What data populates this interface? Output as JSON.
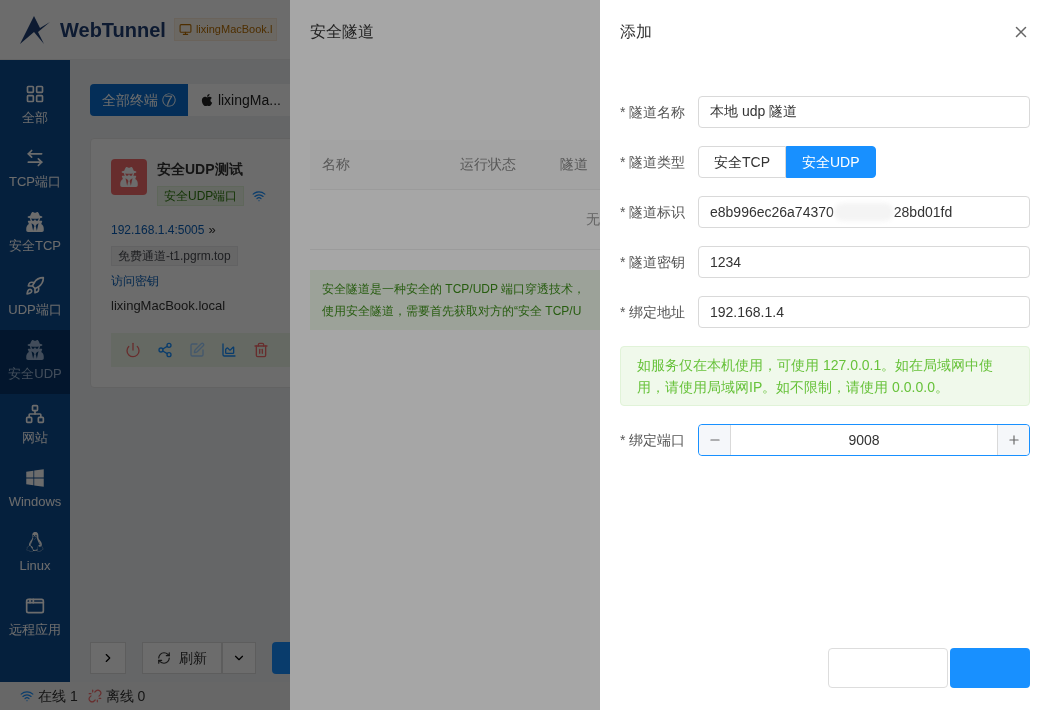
{
  "app": {
    "logo": "WebTunnel",
    "device_tag": "lixingMacBook.l",
    "sidebar": [
      {
        "label": "全部",
        "selected": false
      },
      {
        "label": "TCP端口",
        "selected": false
      },
      {
        "label": "安全TCP",
        "selected": false
      },
      {
        "label": "UDP端口",
        "selected": false
      },
      {
        "label": "安全UDP",
        "selected": true
      },
      {
        "label": "网站",
        "selected": false
      },
      {
        "label": "Windows",
        "selected": false
      },
      {
        "label": "Linux",
        "selected": false
      },
      {
        "label": "远程应用",
        "selected": false
      }
    ],
    "tabs": [
      {
        "label": "全部终端 ⑦",
        "selected": true
      },
      {
        "label": "lixingMa...",
        "selected": false
      }
    ],
    "card": {
      "title": "安全UDP测试",
      "tag": "安全UDP端口",
      "address": "192.168.1.4:5005",
      "address_arrow": "»",
      "channel": "免费通道-t1.pgrm.top",
      "key_link": "访问密钥",
      "host": "lixingMacBook.local"
    },
    "refresh": "刷新",
    "status": {
      "online": "在线 1",
      "offline": "离线 0"
    }
  },
  "tunnel_panel": {
    "title": "安全隧道",
    "columns": [
      "名称",
      "运行状态",
      "隧道"
    ],
    "empty": "无",
    "notice": [
      "安全隧道是一种安全的 TCP/UDP 端口穿透技术，",
      "使用安全隧道，需要首先获取对方的“安全 TCP/U"
    ]
  },
  "form": {
    "title": "添加",
    "fields": [
      {
        "kind": "text",
        "label": "* 隧道名称",
        "value": "本地 udp 隧道"
      },
      {
        "kind": "radio",
        "label": "* 隧道类型",
        "options": [
          {
            "label": "安全TCP",
            "selected": false
          },
          {
            "label": "安全UDP",
            "selected": true
          }
        ]
      },
      {
        "kind": "masked",
        "label": "* 隧道标识",
        "value_parts": [
          "e8b996ec26a74370",
          "28bd01fd"
        ]
      },
      {
        "kind": "text",
        "label": "* 隧道密钥",
        "value": "1234"
      },
      {
        "kind": "text",
        "label": "* 绑定地址",
        "value": "192.168.1.4"
      },
      {
        "kind": "hint",
        "text": "如服务仅在本机使用，可使用 127.0.0.1。如在局域网中使用，请使用局域网IP。如不限制，请使用 0.0.0.0。"
      },
      {
        "kind": "number",
        "label": "* 绑定端口",
        "value": "9008",
        "focused": true
      }
    ]
  }
}
